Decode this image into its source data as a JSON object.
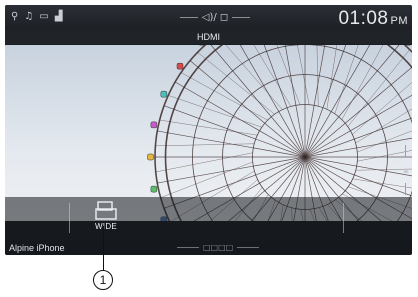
{
  "status_bar": {
    "icons": [
      "bluetooth-phone-icon",
      "bluetooth-audio-icon",
      "battery-icon",
      "signal-icon"
    ],
    "icon_glyphs": [
      "⚲",
      "♫",
      "▭",
      "▟"
    ],
    "center_glyph": "◁)/ ◻",
    "time": "01:08",
    "ampm": "PM"
  },
  "source": {
    "title": "HDMI"
  },
  "controls": {
    "wide_label": "WIDE"
  },
  "footer": {
    "device_name": "Alpine iPhone",
    "center_glyph": "□□□□"
  },
  "annotation": {
    "callout_number": "1"
  },
  "colors": {
    "screen_bg": "#1a1d22",
    "text": "#e8ecf2",
    "wheel": "#3a2a2a"
  }
}
